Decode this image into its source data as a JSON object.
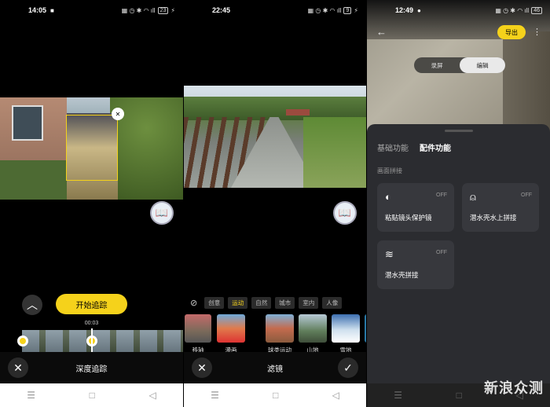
{
  "panel1": {
    "status_time": "14:05",
    "battery": "23",
    "start_tracking_label": "开始追踪",
    "timecode": "00:03",
    "bottom_title": "深度追踪",
    "close_glyph": "✕",
    "up_glyph": "︿",
    "box_close_glyph": "✕"
  },
  "panel2": {
    "status_time": "22:45",
    "battery": "9",
    "filter_tabs": [
      "创意",
      "运动",
      "自然",
      "城市",
      "室内",
      "人像"
    ],
    "active_filter_tab": "运动",
    "thumbnails": [
      "移轴",
      "漫画",
      "球类运动",
      "山地",
      "雪地"
    ],
    "bottom_title": "滤镜",
    "close_glyph": "✕",
    "check_glyph": "✓"
  },
  "panel3": {
    "status_time": "12:49",
    "battery": "46",
    "back_glyph": "←",
    "export_label": "导出",
    "more_glyph": "⋮",
    "mode_toggle": [
      "录屏",
      "编辑"
    ],
    "active_mode": "编辑",
    "tabs": [
      "基础功能",
      "配件功能"
    ],
    "active_tab": "配件功能",
    "section_title": "画面拼接",
    "cards": [
      {
        "name": "粘贴镜头保护镜",
        "status": "OFF",
        "icon": "lens-guard-icon"
      },
      {
        "name": "潜水壳水上拼接",
        "status": "OFF",
        "icon": "dive-case-icon"
      },
      {
        "name": "潜水壳拼接",
        "status": "OFF",
        "icon": "waves-icon"
      }
    ],
    "watermark": "新浪众测"
  },
  "colors": {
    "accent": "#f5d21b",
    "sheet": "#2b2c30",
    "card": "#37383d"
  }
}
